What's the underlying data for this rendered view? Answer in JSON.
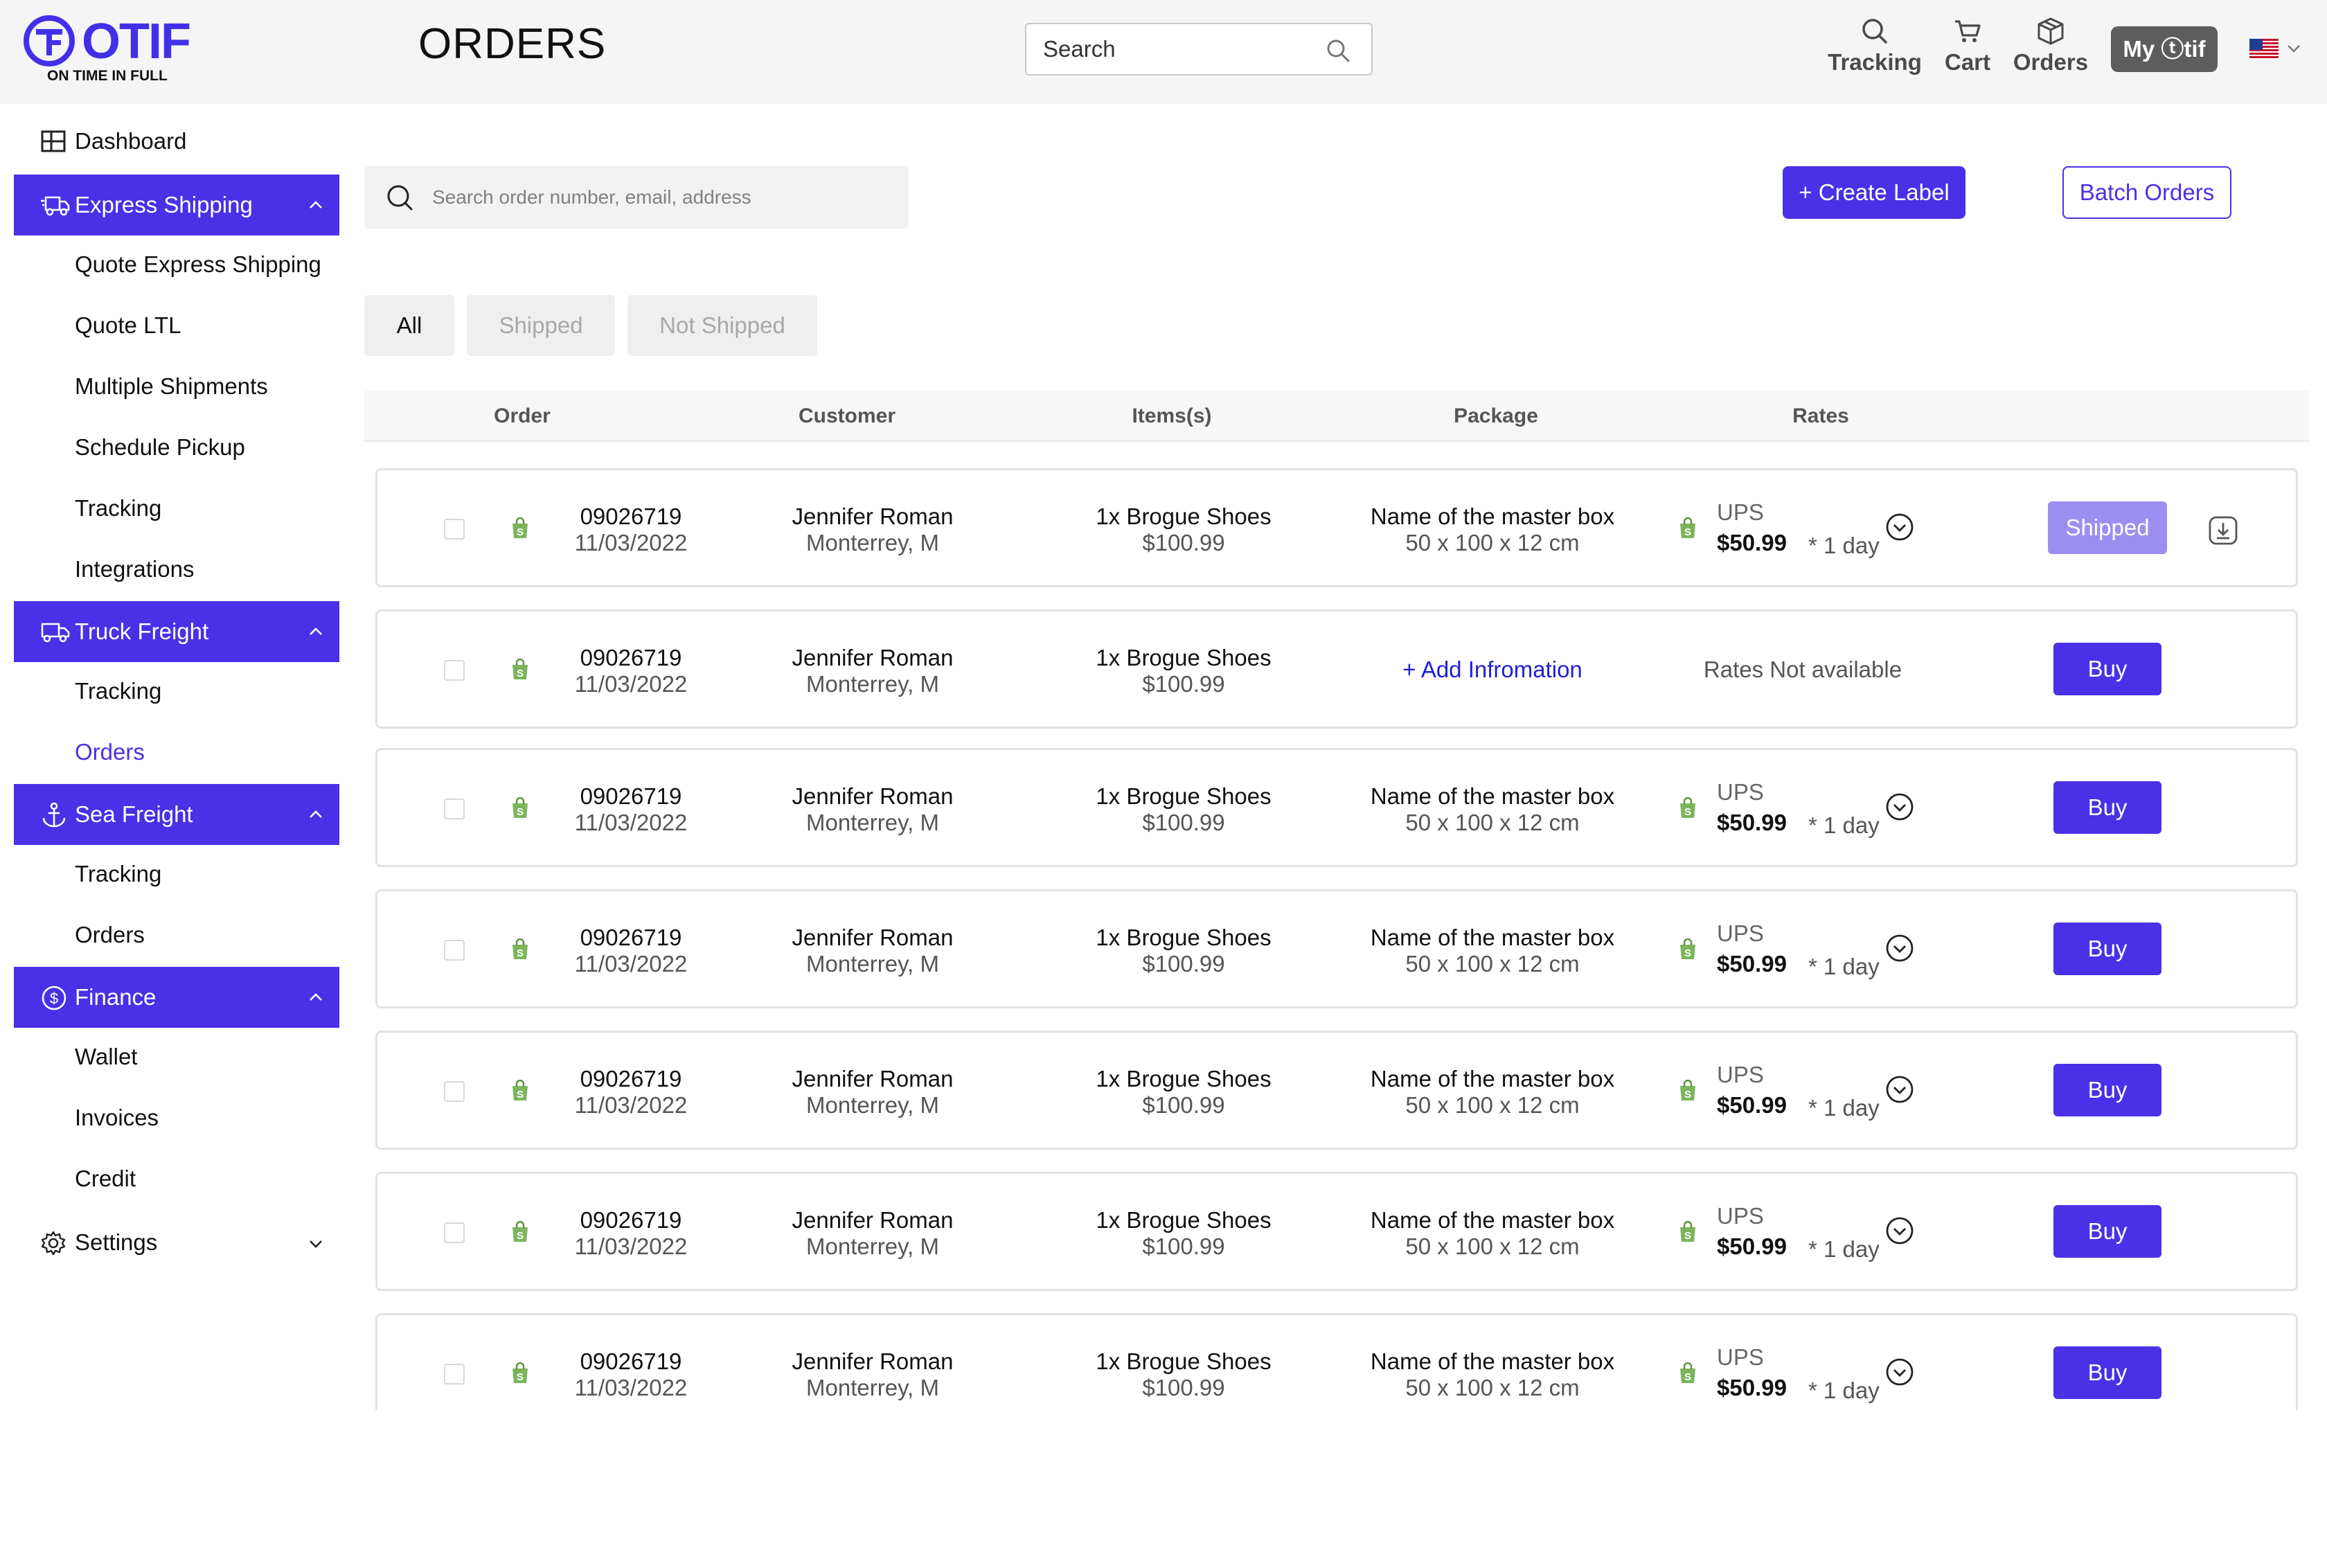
{
  "app": {
    "logo_text": "OTIF",
    "tagline": "ON TIME IN FULL",
    "page_title": "ORDERS",
    "brand_color": "#4a30e6"
  },
  "header": {
    "search_placeholder": "Search",
    "nav": [
      {
        "label": "Tracking",
        "icon": "search-icon"
      },
      {
        "label": "Cart",
        "icon": "cart-icon"
      },
      {
        "label": "Orders",
        "icon": "box-icon"
      }
    ],
    "account_button": "My ⓣtif",
    "language_flag": "us-flag-icon"
  },
  "sidebar": {
    "dashboard": "Dashboard",
    "express": {
      "label": "Express Shipping",
      "items": [
        "Quote Express Shipping",
        "Quote LTL",
        "Multiple Shipments",
        "Schedule Pickup",
        "Tracking",
        "Integrations"
      ]
    },
    "truck": {
      "label": "Truck Freight",
      "items": [
        "Tracking",
        "Orders"
      ]
    },
    "sea": {
      "label": "Sea Freight",
      "items": [
        "Tracking",
        "Orders"
      ]
    },
    "finance": {
      "label": "Finance",
      "items": [
        "Wallet",
        "Invoices",
        "Credit"
      ]
    },
    "settings": "Settings"
  },
  "toolbar": {
    "search_placeholder": "Search order number, email, address",
    "create_label": "+ Create Label",
    "batch_orders": "Batch Orders"
  },
  "tabs": [
    "All",
    "Shipped",
    "Not Shipped"
  ],
  "table": {
    "columns": [
      "Order",
      "Customer",
      "Items(s)",
      "Package",
      "Rates"
    ],
    "rows": [
      {
        "order_no": "09026719",
        "date": "11/03/2022",
        "customer": "Jennifer Roman",
        "location": "Monterrey, M",
        "item": "1x Brogue Shoes",
        "item_price": "$100.99",
        "package_name": "Name of the master box",
        "package_dims": "50 x 100 x 12 cm",
        "carrier": "UPS",
        "rate": "$50.99",
        "eta": "* 1 day",
        "action": "Shipped"
      },
      {
        "order_no": "09026719",
        "date": "11/03/2022",
        "customer": "Jennifer Roman",
        "location": "Monterrey, M",
        "item": "1x Brogue Shoes",
        "item_price": "$100.99",
        "add_info": "+ Add Infromation",
        "rates_na": "Rates Not available",
        "action": "Buy"
      },
      {
        "order_no": "09026719",
        "date": "11/03/2022",
        "customer": "Jennifer Roman",
        "location": "Monterrey, M",
        "item": "1x Brogue Shoes",
        "item_price": "$100.99",
        "package_name": "Name of the master box",
        "package_dims": "50 x 100 x 12 cm",
        "carrier": "UPS",
        "rate": "$50.99",
        "eta": "* 1 day",
        "action": "Buy"
      },
      {
        "order_no": "09026719",
        "date": "11/03/2022",
        "customer": "Jennifer Roman",
        "location": "Monterrey, M",
        "item": "1x Brogue Shoes",
        "item_price": "$100.99",
        "package_name": "Name of the master box",
        "package_dims": "50 x 100 x 12 cm",
        "carrier": "UPS",
        "rate": "$50.99",
        "eta": "* 1 day",
        "action": "Buy"
      },
      {
        "order_no": "09026719",
        "date": "11/03/2022",
        "customer": "Jennifer Roman",
        "location": "Monterrey, M",
        "item": "1x Brogue Shoes",
        "item_price": "$100.99",
        "package_name": "Name of the master box",
        "package_dims": "50 x 100 x 12 cm",
        "carrier": "UPS",
        "rate": "$50.99",
        "eta": "* 1 day",
        "action": "Buy"
      },
      {
        "order_no": "09026719",
        "date": "11/03/2022",
        "customer": "Jennifer Roman",
        "location": "Monterrey, M",
        "item": "1x Brogue Shoes",
        "item_price": "$100.99",
        "package_name": "Name of the master box",
        "package_dims": "50 x 100 x 12 cm",
        "carrier": "UPS",
        "rate": "$50.99",
        "eta": "* 1 day",
        "action": "Buy"
      },
      {
        "order_no": "09026719",
        "date": "11/03/2022",
        "customer": "Jennifer Roman",
        "location": "Monterrey, M",
        "item": "1x Brogue Shoes",
        "item_price": "$100.99",
        "package_name": "Name of the master box",
        "package_dims": "50 x 100 x 12 cm",
        "carrier": "UPS",
        "rate": "$50.99",
        "eta": "* 1 day",
        "action": "Buy"
      }
    ]
  }
}
